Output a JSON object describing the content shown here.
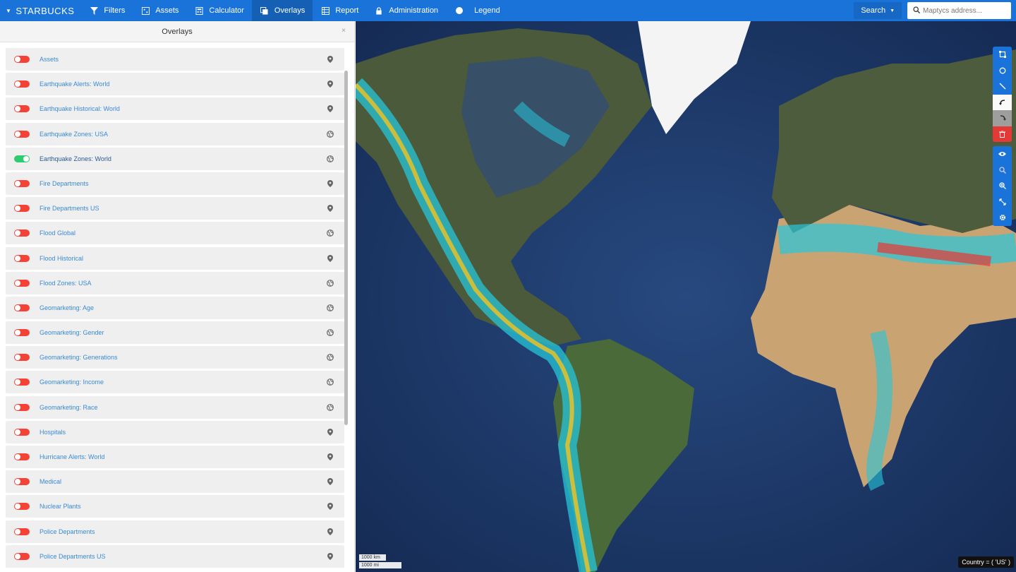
{
  "nav": {
    "brand": "STARBUCKS",
    "items": [
      {
        "label": "Filters",
        "icon": "filter-icon"
      },
      {
        "label": "Assets",
        "icon": "assets-icon"
      },
      {
        "label": "Calculator",
        "icon": "calculator-icon"
      },
      {
        "label": "Overlays",
        "icon": "overlays-icon",
        "active": true
      },
      {
        "label": "Report",
        "icon": "report-icon"
      },
      {
        "label": "Administration",
        "icon": "lock-icon"
      }
    ],
    "legend_label": "Legend",
    "search_label": "Search",
    "search_placeholder": "Maptycs address..."
  },
  "panel": {
    "title": "Overlays",
    "close": "×",
    "overlays": [
      {
        "label": "Assets",
        "on": false,
        "icon": "pin-icon"
      },
      {
        "label": "Earthquake Alerts: World",
        "on": false,
        "icon": "pin-icon"
      },
      {
        "label": "Earthquake Historical: World",
        "on": false,
        "icon": "pin-icon"
      },
      {
        "label": "Earthquake Zones: USA",
        "on": false,
        "icon": "globe-icon"
      },
      {
        "label": "Earthquake Zones: World",
        "on": true,
        "icon": "globe-icon"
      },
      {
        "label": "Fire Departments",
        "on": false,
        "icon": "pin-icon"
      },
      {
        "label": "Fire Departments US",
        "on": false,
        "icon": "pin-icon"
      },
      {
        "label": "Flood Global",
        "on": false,
        "icon": "globe-icon"
      },
      {
        "label": "Flood Historical",
        "on": false,
        "icon": "pin-icon"
      },
      {
        "label": "Flood Zones: USA",
        "on": false,
        "icon": "globe-icon"
      },
      {
        "label": "Geomarketing: Age",
        "on": false,
        "icon": "globe-icon"
      },
      {
        "label": "Geomarketing: Gender",
        "on": false,
        "icon": "globe-icon"
      },
      {
        "label": "Geomarketing: Generations",
        "on": false,
        "icon": "globe-icon"
      },
      {
        "label": "Geomarketing: Income",
        "on": false,
        "icon": "globe-icon"
      },
      {
        "label": "Geomarketing: Race",
        "on": false,
        "icon": "globe-icon"
      },
      {
        "label": "Hospitals",
        "on": false,
        "icon": "pin-icon"
      },
      {
        "label": "Hurricane Alerts: World",
        "on": false,
        "icon": "pin-icon"
      },
      {
        "label": "Medical",
        "on": false,
        "icon": "pin-icon"
      },
      {
        "label": "Nuclear Plants",
        "on": false,
        "icon": "pin-icon"
      },
      {
        "label": "Police Departments",
        "on": false,
        "icon": "pin-icon"
      },
      {
        "label": "Police Departments US",
        "on": false,
        "icon": "pin-icon"
      }
    ]
  },
  "map": {
    "scale_km": "1000 km",
    "scale_mi": "1000 mi",
    "filter_badge": "Country = ( 'US' )",
    "tools": [
      {
        "name": "draw-rectangle-icon",
        "style": "blue"
      },
      {
        "name": "draw-circle-icon",
        "style": "blue"
      },
      {
        "name": "draw-line-icon",
        "style": "blue"
      },
      {
        "name": "undo-icon",
        "style": "white"
      },
      {
        "name": "redo-icon",
        "style": "grey"
      },
      {
        "name": "trash-icon",
        "style": "red"
      }
    ],
    "view_tools": [
      {
        "name": "visibility-icon"
      },
      {
        "name": "zoom-out-icon"
      },
      {
        "name": "zoom-in-icon"
      },
      {
        "name": "fullscreen-icon"
      },
      {
        "name": "settings-icon"
      }
    ]
  },
  "colors": {
    "nav": "#1a73d9",
    "toggle_off": "#f44336",
    "toggle_on": "#2ecc71",
    "link": "#3a8ad6"
  }
}
